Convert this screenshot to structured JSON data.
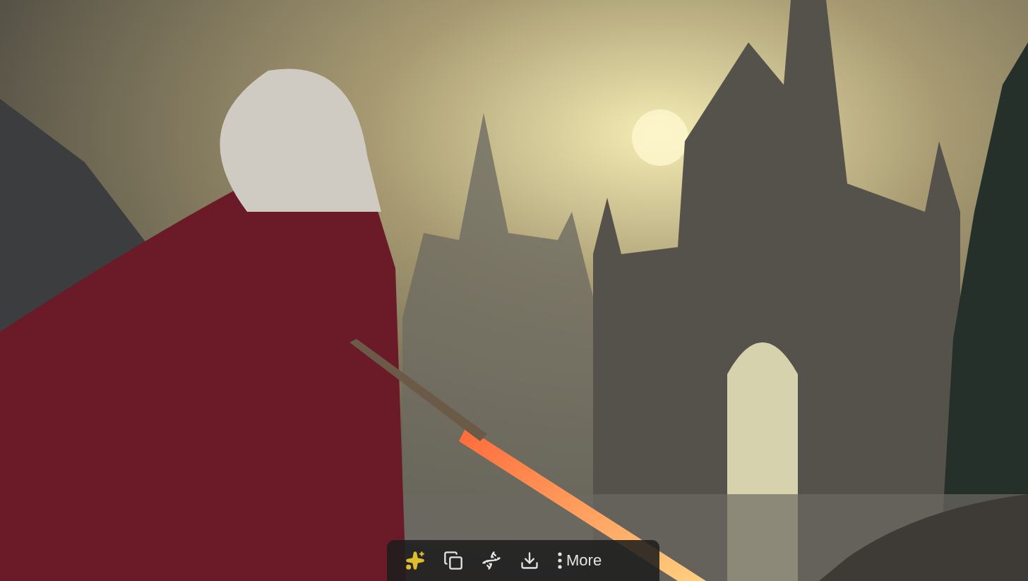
{
  "toolbar": {
    "buttons": [
      {
        "kind": "sparkles"
      },
      {
        "kind": "copy"
      },
      {
        "kind": "dna"
      },
      {
        "kind": "download"
      },
      {
        "kind": "more",
        "label": "More"
      }
    ]
  }
}
